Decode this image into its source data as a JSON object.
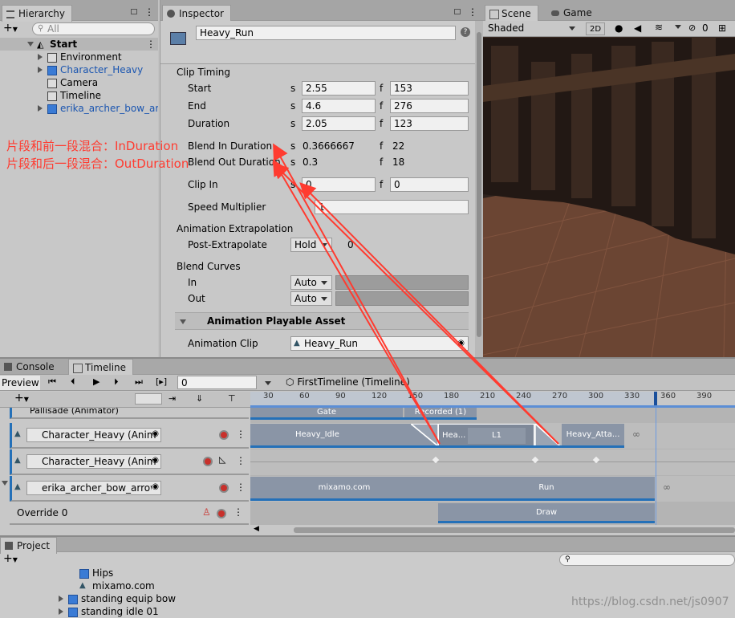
{
  "hierarchy": {
    "tab": "Hierarchy",
    "search_placeholder": "All",
    "add_label": "+",
    "items": [
      {
        "label": "Start"
      },
      {
        "label": "Environment"
      },
      {
        "label": "Character_Heavy"
      },
      {
        "label": "Camera"
      },
      {
        "label": "Timeline"
      },
      {
        "label": "erika_archer_bow_arro"
      }
    ]
  },
  "inspector": {
    "tab": "Inspector",
    "object_name": "Heavy_Run",
    "clip_timing": {
      "header": "Clip Timing",
      "start_label": "Start",
      "start_s": "2.55",
      "start_f": "153",
      "end_label": "End",
      "end_s": "4.6",
      "end_f": "276",
      "duration_label": "Duration",
      "duration_s": "2.05",
      "duration_f": "123",
      "blend_in_label": "Blend In Duration",
      "blend_in_s": "0.3666667",
      "blend_in_f": "22",
      "blend_out_label": "Blend Out Duration",
      "blend_out_s": "0.3",
      "blend_out_f": "18",
      "clip_in_label": "Clip In",
      "clip_in_s": "0",
      "clip_in_f": "0",
      "speed_label": "Speed Multiplier",
      "speed_value": "1",
      "s_unit": "s",
      "f_unit": "f"
    },
    "extrapolation": {
      "header": "Animation Extrapolation",
      "post_label": "Post-Extrapolate",
      "post_value": "Hold",
      "post_number": "0"
    },
    "blend_curves": {
      "header": "Blend Curves",
      "in_label": "In",
      "in_value": "Auto",
      "out_label": "Out",
      "out_value": "Auto"
    },
    "asset": {
      "header": "Animation Playable Asset",
      "clip_label": "Animation Clip",
      "clip_value": "Heavy_Run"
    }
  },
  "scene": {
    "tab_scene": "Scene",
    "tab_game": "Game",
    "shading": "Shaded",
    "btn_2d": "2D",
    "hidden_count": "0"
  },
  "annotations": {
    "line1": "片段和前一段混合：InDuration",
    "line2": "片段和后一段混合：OutDuration"
  },
  "timeline": {
    "tab_console": "Console",
    "tab_timeline": "Timeline",
    "preview_label": "Preview",
    "frame_value": "0",
    "breadcrumb": "FirstTimeline (Timeline)",
    "ruler": [
      "30",
      "60",
      "90",
      "120",
      "150",
      "180",
      "210",
      "240",
      "270",
      "300",
      "330",
      "360",
      "390"
    ],
    "tracks": [
      {
        "label": "Pallisade (Animator)"
      },
      {
        "label": "Character_Heavy (Anim"
      },
      {
        "label": "Character_Heavy (Anim"
      },
      {
        "label": "erika_archer_bow_arrow"
      },
      {
        "label": "Override 0"
      }
    ],
    "clips": {
      "gate": "Gate",
      "recorded": "Recorded (1)",
      "heavy_idle": "Heavy_Idle",
      "heavy_run": "Hea...",
      "l1": "L1",
      "heavy_attack": "Heavy_Atta...",
      "mixamo": "mixamo.com",
      "run": "Run",
      "draw": "Draw"
    }
  },
  "project": {
    "tab": "Project",
    "items": [
      {
        "label": "Hips"
      },
      {
        "label": "mixamo.com"
      },
      {
        "label": "standing equip bow"
      },
      {
        "label": "standing idle 01"
      }
    ],
    "watermark": "https://blog.csdn.net/js0907"
  }
}
